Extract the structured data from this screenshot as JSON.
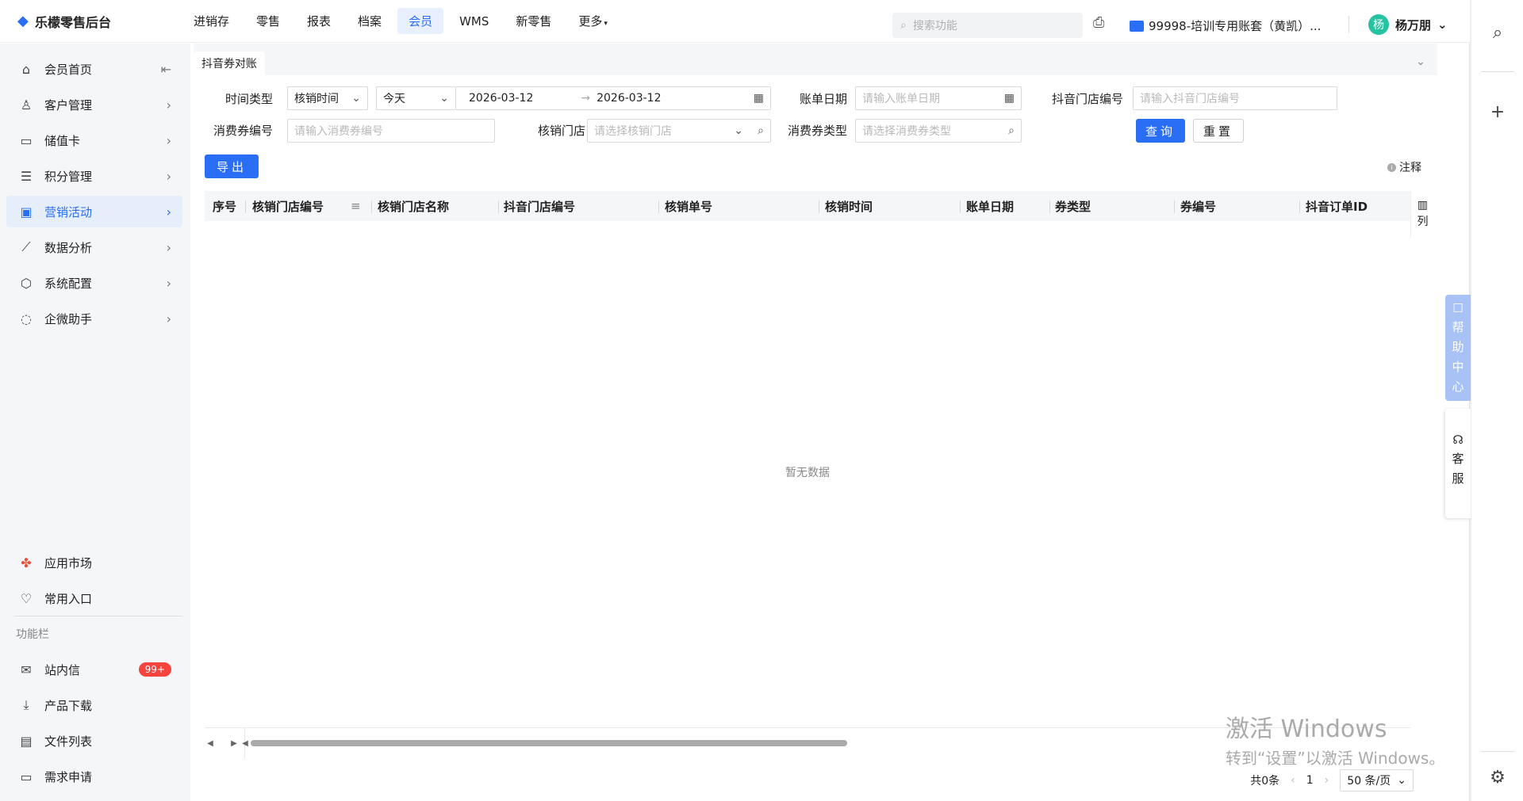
{
  "app": {
    "logo": "乐檬零售后台",
    "nav": [
      "进销存",
      "零售",
      "报表",
      "档案",
      "会员",
      "WMS",
      "新零售",
      "更多"
    ],
    "nav_active": "会员",
    "search_placeholder": "搜索功能",
    "account": "99998-培训专用账套（黄凯）...",
    "user": "杨万朋",
    "avatar_char": "杨"
  },
  "sidebar": {
    "items": [
      {
        "label": "会员首页",
        "icon": "home-icon"
      },
      {
        "label": "客户管理",
        "icon": "user-icon"
      },
      {
        "label": "储值卡",
        "icon": "card-icon"
      },
      {
        "label": "积分管理",
        "icon": "database-icon"
      },
      {
        "label": "营销活动",
        "icon": "marketing-icon"
      },
      {
        "label": "数据分析",
        "icon": "chart-icon"
      },
      {
        "label": "系统配置",
        "icon": "settings-icon"
      },
      {
        "label": "企微助手",
        "icon": "chat-icon"
      }
    ],
    "active": "营销活动",
    "lower": [
      {
        "label": "应用市场",
        "icon": "app-market-icon"
      },
      {
        "label": "常用入口",
        "icon": "heart-icon"
      }
    ],
    "section_label": "功能栏",
    "func": [
      {
        "label": "站内信",
        "icon": "mail-icon",
        "badge": "99+"
      },
      {
        "label": "产品下载",
        "icon": "download-icon"
      },
      {
        "label": "文件列表",
        "icon": "file-list-icon"
      },
      {
        "label": "需求申请",
        "icon": "request-icon"
      }
    ]
  },
  "tab": {
    "label": "抖音券对账"
  },
  "filters": {
    "time_type_label": "时间类型",
    "time_type_value": "核销时间",
    "period_value": "今天",
    "date_start": "2026-03-12",
    "date_end": "2026-03-12",
    "bill_date_label": "账单日期",
    "bill_date_placeholder": "请输入账单日期",
    "douyin_store_label": "抖音门店编号",
    "douyin_store_placeholder": "请输入抖音门店编号",
    "coupon_no_label": "消费券编号",
    "coupon_no_placeholder": "请输入消费券编号",
    "verify_store_label": "核销门店",
    "verify_store_placeholder": "请选择核销门店",
    "coupon_type_label": "消费券类型",
    "coupon_type_placeholder": "请选择消费券类型",
    "query": "查询",
    "reset": "重置",
    "export": "导出",
    "note": "注释"
  },
  "table": {
    "columns": [
      "序号",
      "核销门店编号",
      "核销门店名称",
      "抖音门店编号",
      "核销单号",
      "核销时间",
      "账单日期",
      "券类型",
      "券编号",
      "抖音订单ID"
    ],
    "col_setting": "列",
    "empty": "暂无数据"
  },
  "pager": {
    "total": "共0条",
    "page": "1",
    "size": "50 条/页"
  },
  "float": {
    "help": [
      "帮",
      "助",
      "中",
      "心"
    ],
    "service": [
      "客",
      "服"
    ]
  },
  "watermark": {
    "line1": "激活 Windows",
    "line2": "转到“设置”以激活 Windows。"
  }
}
